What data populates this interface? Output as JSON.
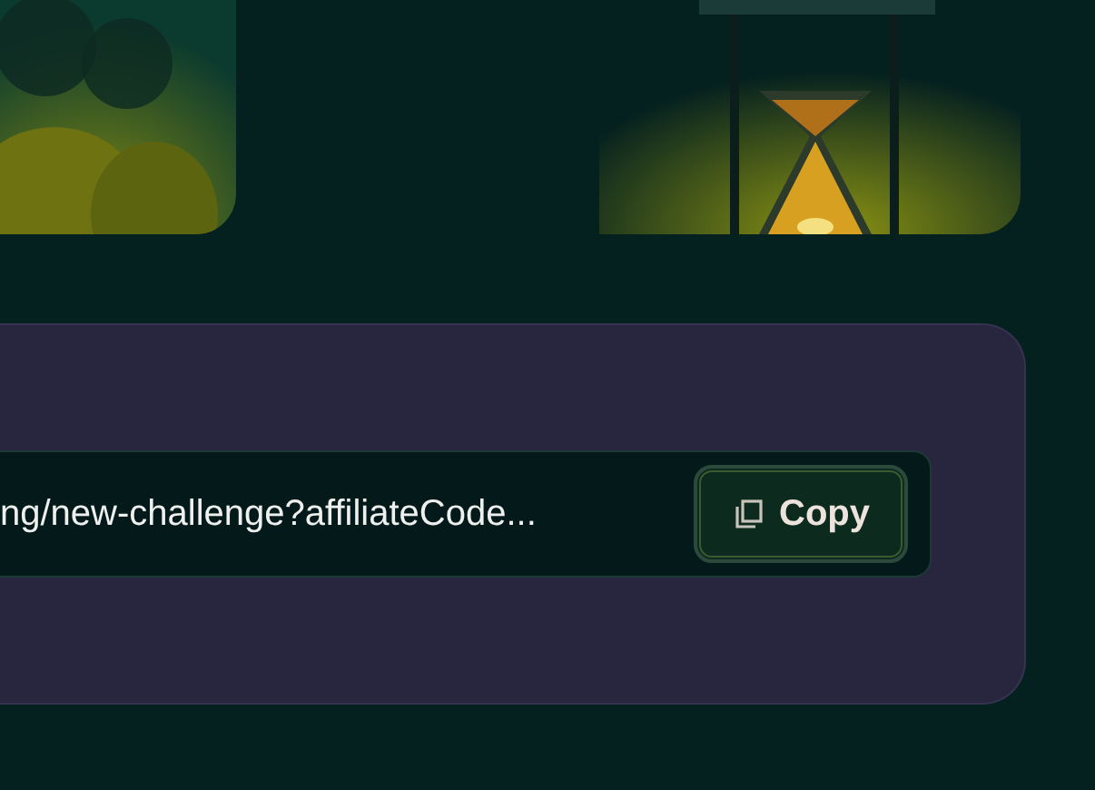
{
  "referral": {
    "link": "ng/new-challenge?affiliateCode...",
    "copy_button": "Copy"
  }
}
